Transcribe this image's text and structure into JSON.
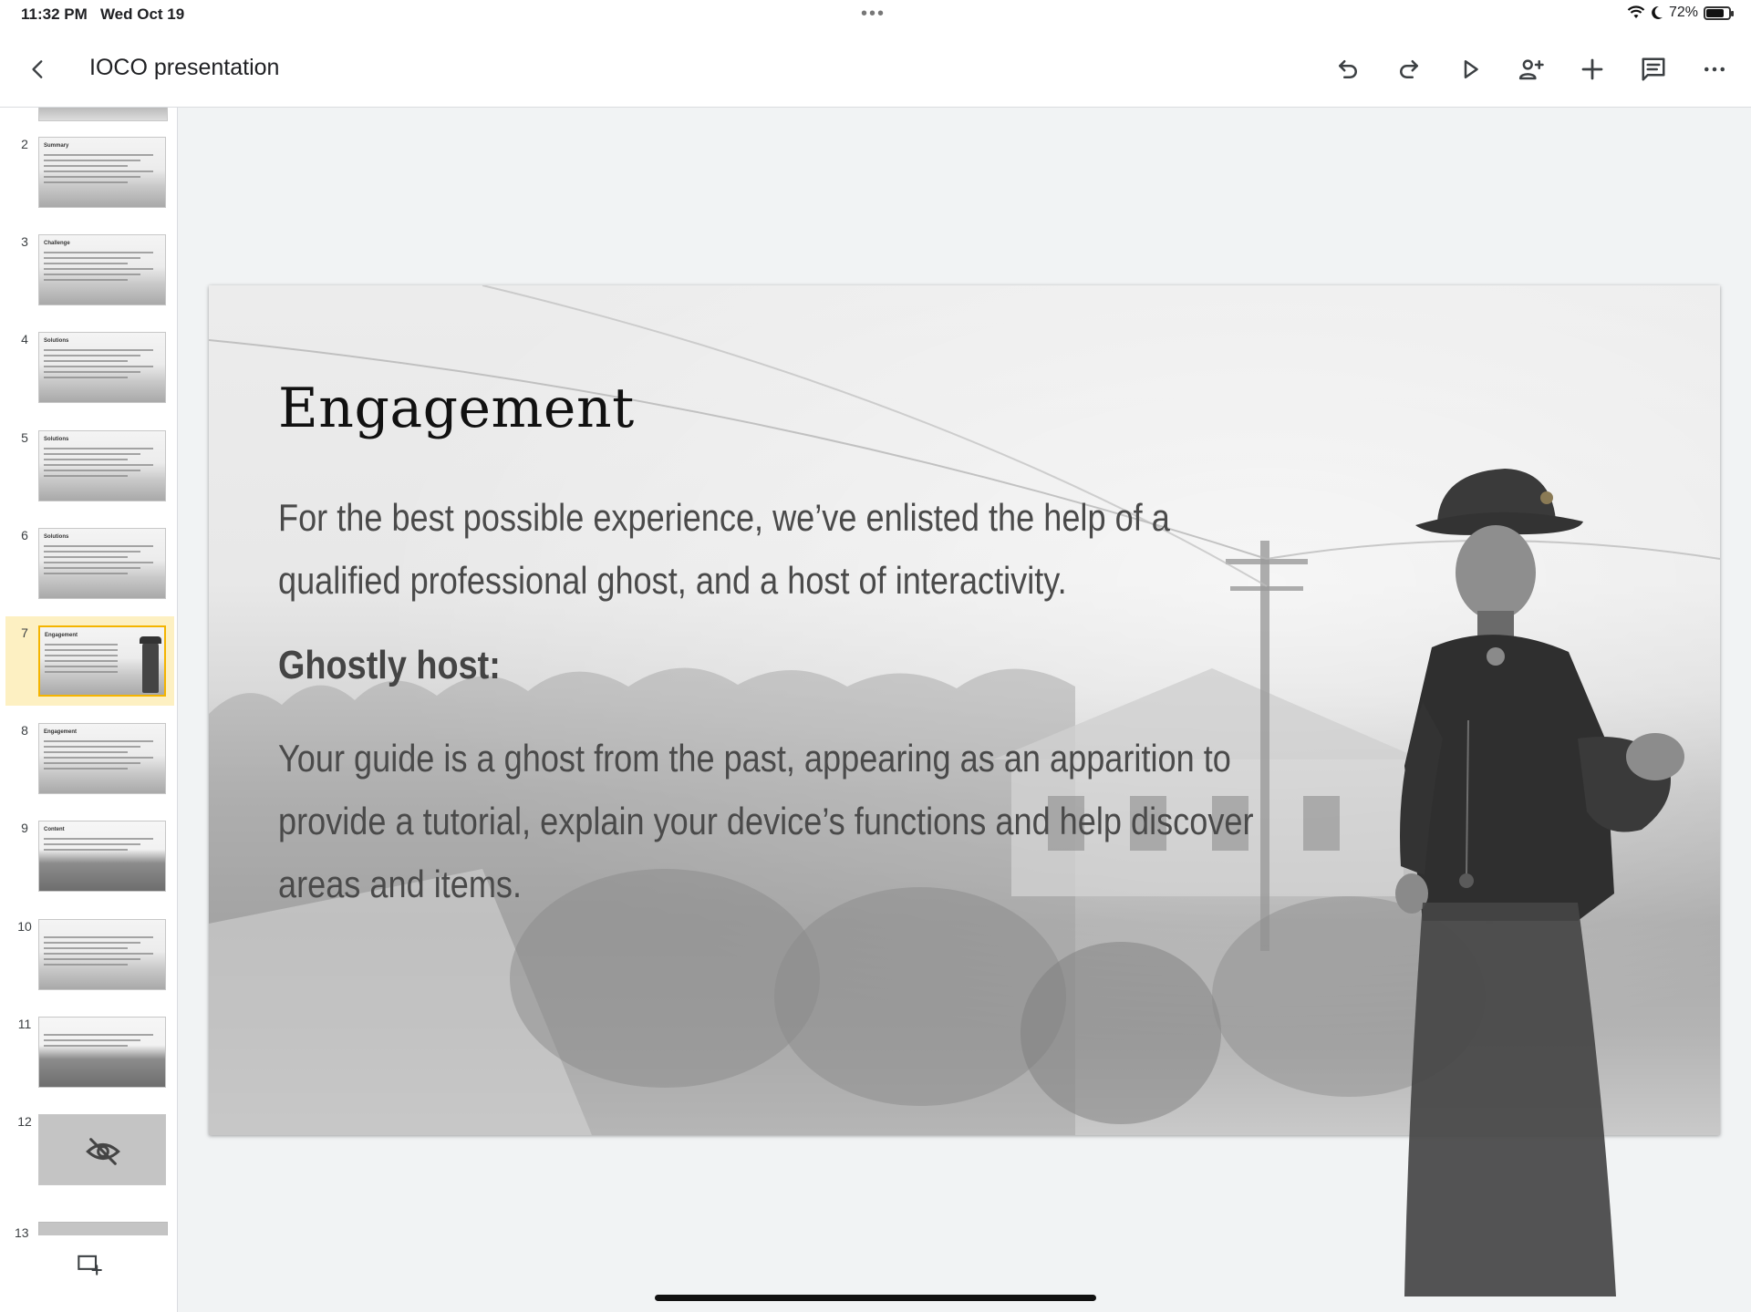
{
  "status_bar": {
    "time": "11:32 PM",
    "date": "Wed Oct 19",
    "battery_text": "72%",
    "battery_level": 0.72,
    "icons": [
      "wifi-icon",
      "moon-icon",
      "battery-icon"
    ]
  },
  "header": {
    "title": "IOCO presentation",
    "toolbar": [
      "undo-icon",
      "redo-icon",
      "present-icon",
      "add-person-icon",
      "add-icon",
      "comment-icon",
      "more-icon"
    ]
  },
  "filmstrip": {
    "selected": "7",
    "slides": [
      {
        "num": "2",
        "title": "Summary",
        "kind": "text"
      },
      {
        "num": "3",
        "title": "Challenge",
        "kind": "text"
      },
      {
        "num": "4",
        "title": "Solutions",
        "kind": "text"
      },
      {
        "num": "5",
        "title": "Solutions",
        "kind": "text"
      },
      {
        "num": "6",
        "title": "Solutions",
        "kind": "text"
      },
      {
        "num": "7",
        "title": "Engagement",
        "kind": "ghost"
      },
      {
        "num": "8",
        "title": "Engagement",
        "kind": "text"
      },
      {
        "num": "9",
        "title": "Content",
        "kind": "photo"
      },
      {
        "num": "10",
        "title": "",
        "kind": "text"
      },
      {
        "num": "11",
        "title": "",
        "kind": "photo"
      },
      {
        "num": "12",
        "title": "",
        "kind": "hidden"
      }
    ],
    "partial_next": "13"
  },
  "slide": {
    "title": "Engagement",
    "intro": "For the best possible experience, we’ve enlisted the help of a qualified professional ghost, and a host of interactivity.",
    "subheading": "Ghostly host:",
    "body": "Your guide is a ghost from the past, appearing as an apparition to provide a tutorial, explain your device’s functions and help discover areas and items."
  }
}
